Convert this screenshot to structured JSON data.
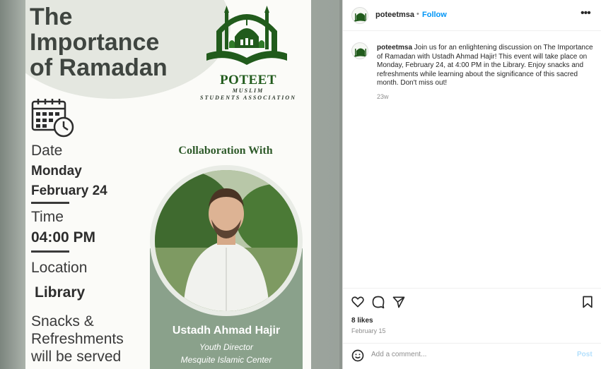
{
  "poster": {
    "title_line1": "The",
    "title_line2": "Importance",
    "title_line3": "of Ramadan",
    "logo_name": "POTEET",
    "logo_sub1": "MUSLIM",
    "logo_sub2": "STUDENTS ASSOCIATION",
    "date_label": "Date",
    "date_day": "Monday",
    "date_value": "February 24",
    "time_label": "Time",
    "time_value": "04:00 PM",
    "location_label": "Location",
    "location_value": "Library",
    "snacks_line1": "Snacks &",
    "snacks_line2": "Refreshments",
    "snacks_line3": "will be served",
    "collab": "Collaboration With",
    "speaker_name": "Ustadh Ahmad Hajir",
    "speaker_role": "Youth Director",
    "speaker_org": "Mesquite Islamic Center"
  },
  "instagram": {
    "username": "poteetmsa",
    "dot": "•",
    "follow": "Follow",
    "more": "•••",
    "caption_user": "poteetmsa",
    "caption_text": " Join us for an enlightening discussion on The Importance of Ramadan with Ustadh Ahmad Hajir! This event will take place on Monday, February 24, at 4:00 PM in the Library. Enjoy snacks and refreshments while learning about the significance of this sacred month. Don't miss out!",
    "age": "23w",
    "likes": "8 likes",
    "date": "February 15",
    "comment_placeholder": "Add a comment...",
    "post": "Post"
  },
  "colors": {
    "brand_green": "#215b1c",
    "panel_green": "#8aa18b",
    "link_blue": "#0095f6"
  },
  "icons": [
    "calendar-clock-icon",
    "mosque-logo-icon",
    "heart-icon",
    "comment-icon",
    "share-icon",
    "bookmark-icon",
    "emoji-icon",
    "more-icon"
  ]
}
